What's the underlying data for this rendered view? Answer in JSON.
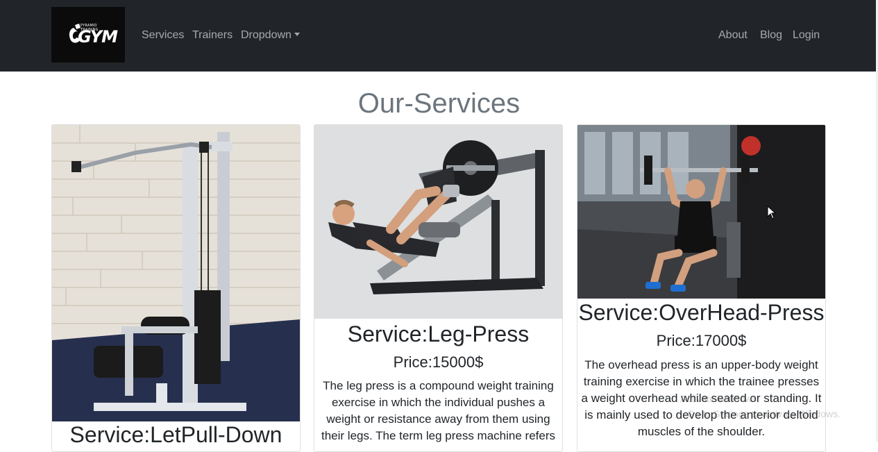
{
  "nav": {
    "logo_text": "GYM",
    "logo_tagline": "PYRAMID TRAINING",
    "left_links": [
      "Services",
      "Trainers",
      "Dropdown"
    ],
    "right_links": [
      "About",
      "Blog",
      "Login"
    ]
  },
  "page_title": "Our-Services",
  "cards": [
    {
      "title": "Service:LetPull-Down",
      "image": "lat-pulldown-machine"
    },
    {
      "title": "Service:Leg-Press",
      "price": "Price:15000$",
      "description": "The leg press is a compound weight training exercise in which the individual pushes a weight or resistance away from them using their legs. The term leg press machine refers",
      "image": "leg-press-machine"
    },
    {
      "title": "Service:OverHead-Press",
      "price": "Price:17000$",
      "description": "The overhead press is an upper-body weight training exercise in which the trainee presses a weight overhead while seated or standing. It is mainly used to develop the anterior deltoid muscles of the shoulder.",
      "image": "overhead-press-athlete"
    }
  ],
  "watermark": {
    "line1": "Activate Windows",
    "line2": "Go to Settings to activate Windows."
  },
  "colors": {
    "navbar": "#212529",
    "nav_link": "rgba(255,255,255,0.6)",
    "title": "#6c757d"
  }
}
